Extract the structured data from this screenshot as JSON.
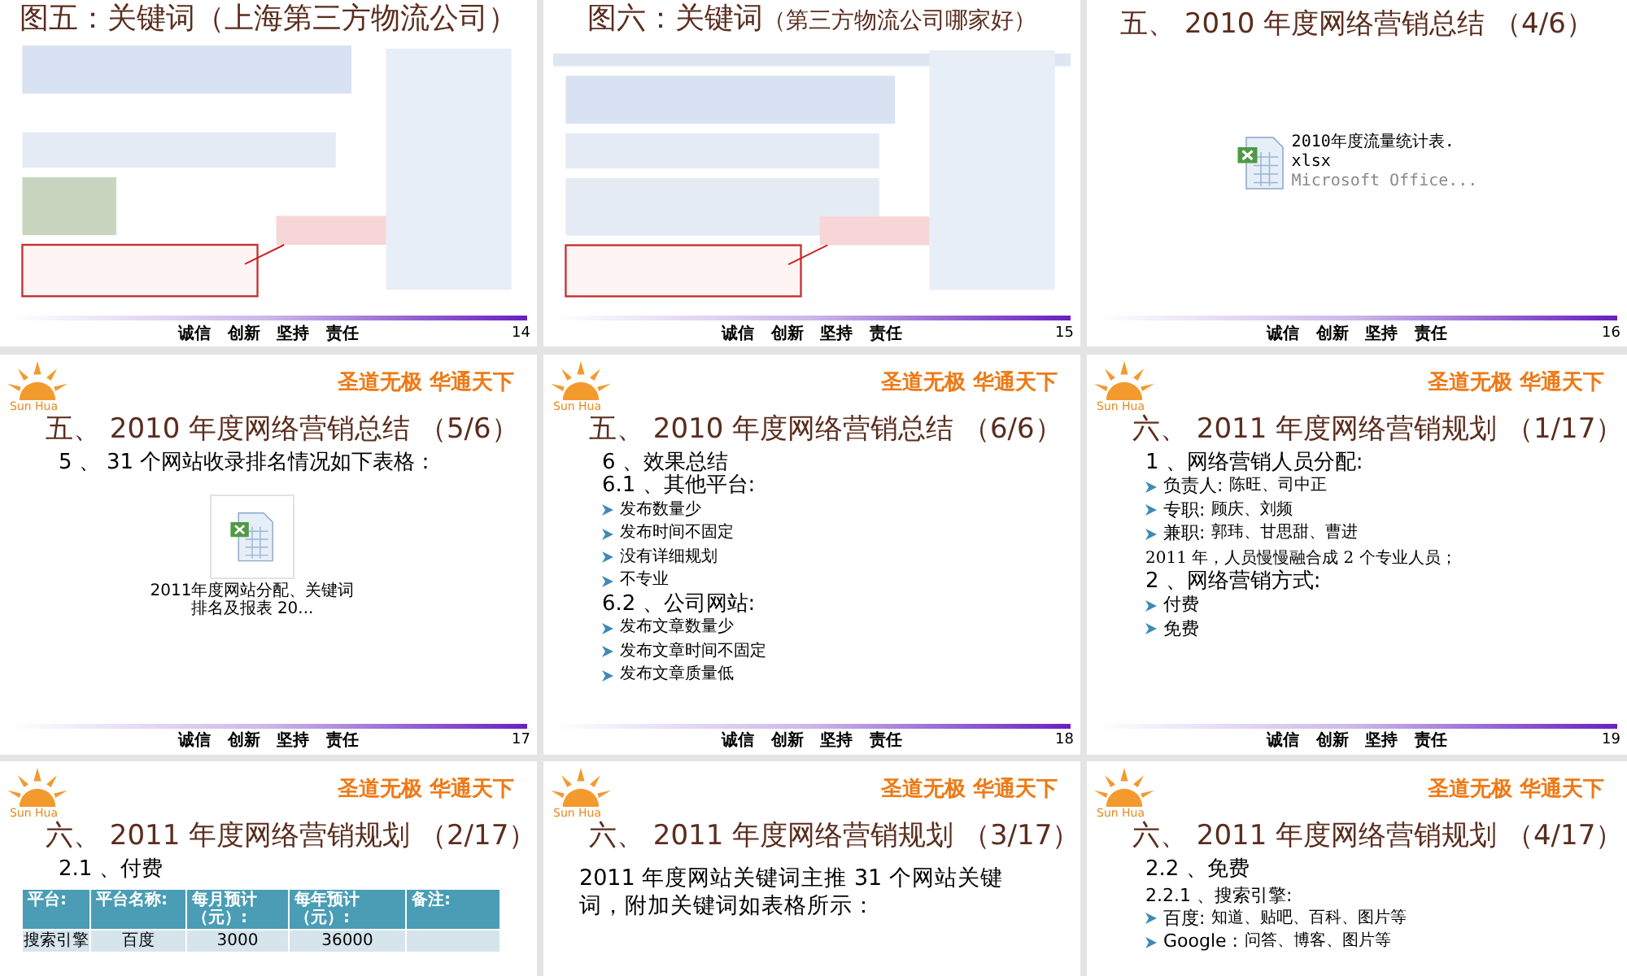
{
  "slides": [
    {
      "kind": "screenshot",
      "title": "图五：关键词（上海第三方物流公司）",
      "motto": "诚信 创新 坚持 责任",
      "page": "14"
    },
    {
      "kind": "screenshot",
      "title": "图六：关键词",
      "title_note": "（第三方物流公司哪家好）",
      "motto": "诚信 创新 坚持 责任",
      "page": "15"
    },
    {
      "kind": "attachment",
      "title": "五、 2010 年度网络营销总结 （4/6）",
      "attachment": {
        "kind": "inline",
        "lines": [
          "2010年度流量统计表.",
          "xlsx",
          "Microsoft Office..."
        ]
      },
      "motto": "诚信 创新 坚持 责任",
      "page": "16"
    },
    {
      "kind": "attachment",
      "logo": "Sun Hua",
      "slogan": "圣道无极 华通天下",
      "title": "五、 2010 年度网络营销总结 （5/6）",
      "lines": [
        {
          "kind": "heading",
          "text": "5 、 31 个网站收录排名情况如下表格："
        }
      ],
      "attachment": {
        "kind": "tile",
        "lines": [
          "2011年度网站分配、关键词排名及报表 20..."
        ]
      },
      "motto": "诚信 创新 坚持 责任",
      "page": "17"
    },
    {
      "kind": "list",
      "logo": "Sun Hua",
      "slogan": "圣道无极 华通天下",
      "title": "五、 2010 年度网络营销总结 （6/6）",
      "lines": [
        {
          "kind": "heading",
          "text": "6 、效果总结"
        },
        {
          "kind": "heading",
          "text": "6.1 、其他平台:"
        },
        {
          "kind": "bullet",
          "text": "发布数量少"
        },
        {
          "kind": "bullet",
          "text": "发布时间不固定"
        },
        {
          "kind": "bullet",
          "text": "没有详细规划"
        },
        {
          "kind": "bullet",
          "text": "不专业"
        },
        {
          "kind": "heading",
          "text": "6.2 、公司网站:"
        },
        {
          "kind": "bullet",
          "text": "发布文章数量少"
        },
        {
          "kind": "bullet",
          "text": "发布文章时间不固定"
        },
        {
          "kind": "bullet",
          "text": "发布文章质量低"
        }
      ],
      "motto": "诚信 创新 坚持 责任",
      "page": "18"
    },
    {
      "kind": "list",
      "logo": "Sun Hua",
      "slogan": "圣道无极 华通天下",
      "title": "六、 2011 年度网络营销规划 （1/17）",
      "lines": [
        {
          "kind": "heading",
          "text": "1 、网络营销人员分配:"
        },
        {
          "kind": "bullet",
          "label": "负责人:",
          "text": "陈旺、司中正"
        },
        {
          "kind": "bullet",
          "label": "专职:",
          "text": "顾庆、刘频"
        },
        {
          "kind": "bullet",
          "label": "兼职:",
          "text": "郭玮、甘思甜、曹进"
        },
        {
          "kind": "paragraph",
          "text": "2011 年，人员慢慢融合成 2 个专业人员；"
        },
        {
          "kind": "heading",
          "text": "2 、网络营销方式:"
        },
        {
          "kind": "bullet",
          "label": "付费"
        },
        {
          "kind": "bullet",
          "label": "免费"
        }
      ],
      "motto": "诚信 创新 坚持 责任",
      "page": "19"
    },
    {
      "kind": "table",
      "logo": "Sun Hua",
      "slogan": "圣道无极 华通天下",
      "title": "六、 2011 年度网络营销规划 （2/17）",
      "lines": [
        {
          "kind": "heading",
          "text": "2.1 、付费"
        }
      ],
      "table": {
        "columns": [
          "平台:",
          "平台名称:",
          "每月预计（元）:",
          "每年预计（元）:",
          "备注:"
        ],
        "rows": [
          [
            "搜索引擎",
            "百度",
            "3000",
            "36000"
          ]
        ]
      }
    },
    {
      "kind": "list",
      "logo": "Sun Hua",
      "slogan": "圣道无极 华通天下",
      "title": "六、 2011 年度网络营销规划 （3/17）",
      "lines": [
        {
          "kind": "lead",
          "text": "2011 年度网站关键词主推 31 个网站关键词，附加关键词如表格所示："
        }
      ]
    },
    {
      "kind": "list",
      "logo": "Sun Hua",
      "slogan": "圣道无极 华通天下",
      "title": "六、 2011 年度网络营销规划 （4/17）",
      "lines": [
        {
          "kind": "heading",
          "text": "2.2 、免费"
        },
        {
          "kind": "subheading",
          "text": "2.2.1 、搜索引擎:"
        },
        {
          "kind": "bullet",
          "label": "百度:",
          "text": "知道、贴吧、百科、图片等"
        },
        {
          "kind": "bullet",
          "label": "Google :",
          "text": "问答、博客、图片等"
        }
      ]
    }
  ]
}
